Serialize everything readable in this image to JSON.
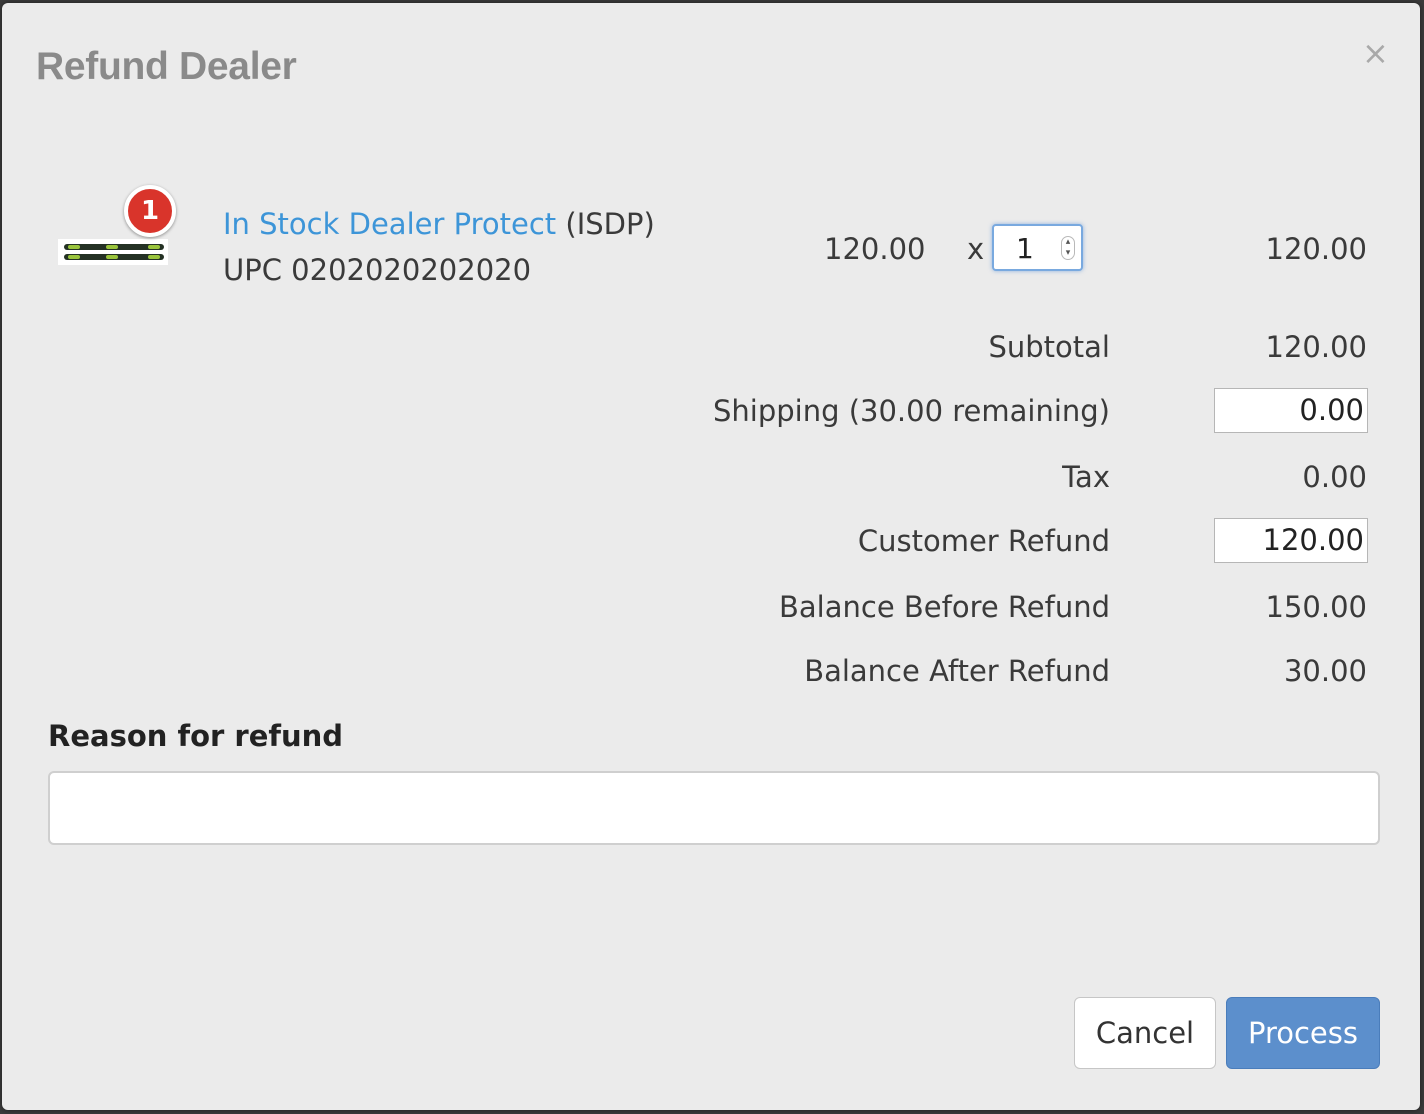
{
  "dialog": {
    "title": "Refund Dealer",
    "close_glyph": "×"
  },
  "item": {
    "badge_count": "1",
    "name": "In Stock Dealer Protect",
    "code": "(ISDP)",
    "upc": "UPC 0202020202020",
    "unit_price": "120.00",
    "times": "x",
    "quantity": "1",
    "line_total": "120.00",
    "thumbnail_icon": "skis-thumbnail"
  },
  "summary": {
    "subtotal_label": "Subtotal",
    "subtotal_value": "120.00",
    "shipping_label": "Shipping (30.00 remaining)",
    "shipping_value": "0.00",
    "tax_label": "Tax",
    "tax_value": "0.00",
    "customer_refund_label": "Customer Refund",
    "customer_refund_value": "120.00",
    "balance_before_label": "Balance Before Refund",
    "balance_before_value": "150.00",
    "balance_after_label": "Balance After Refund",
    "balance_after_value": "30.00"
  },
  "reason": {
    "label": "Reason for refund",
    "value": ""
  },
  "buttons": {
    "cancel": "Cancel",
    "process": "Process"
  },
  "colors": {
    "link": "#3d95d8",
    "primary_button": "#5c8fcc",
    "badge": "#d9342b",
    "dialog_bg": "#ebebeb"
  }
}
